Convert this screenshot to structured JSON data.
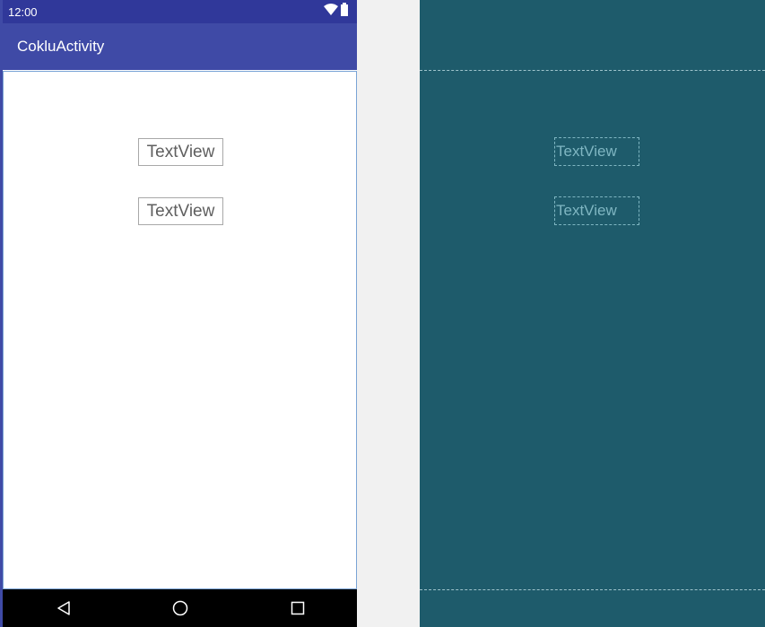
{
  "status_bar": {
    "time": "12:00",
    "icons": [
      "wifi-icon",
      "battery-icon"
    ]
  },
  "app_bar": {
    "title": "CokluActivity"
  },
  "design": {
    "textviews": [
      {
        "text": "TextView"
      },
      {
        "text": "TextView"
      }
    ]
  },
  "blueprint": {
    "textviews": [
      {
        "text": "TextView"
      },
      {
        "text": "TextView"
      }
    ]
  },
  "nav_bar": {
    "buttons": [
      "back-icon",
      "home-icon",
      "recents-icon"
    ]
  },
  "colors": {
    "status_bar": "#30389a",
    "app_bar": "#3f4aa6",
    "blueprint_bg": "#1e5b6b",
    "blueprint_lines": "#7fb6c2",
    "nav_bar": "#000000"
  }
}
